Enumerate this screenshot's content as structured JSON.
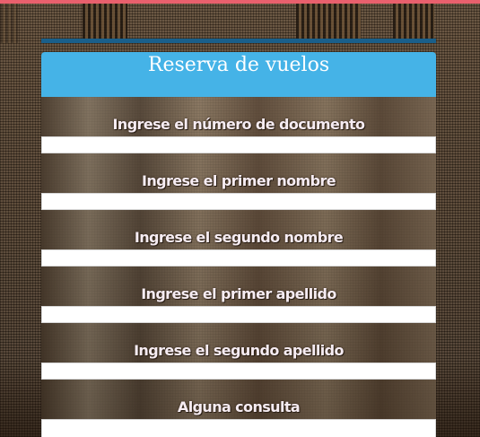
{
  "form": {
    "title": "Reserva de vuelos",
    "fields": [
      {
        "label": "Ingrese el número de documento",
        "value": ""
      },
      {
        "label": "Ingrese el primer nombre",
        "value": ""
      },
      {
        "label": "Ingrese el segundo nombre",
        "value": ""
      },
      {
        "label": "Ingrese el primer apellido",
        "value": ""
      },
      {
        "label": "Ingrese el segundo apellido",
        "value": ""
      },
      {
        "label": "Alguna consulta",
        "value": ""
      }
    ]
  },
  "colors": {
    "header_bg": "#45b3e7",
    "accent_line": "#1a5f8a",
    "top_strip": "#e9606d"
  }
}
